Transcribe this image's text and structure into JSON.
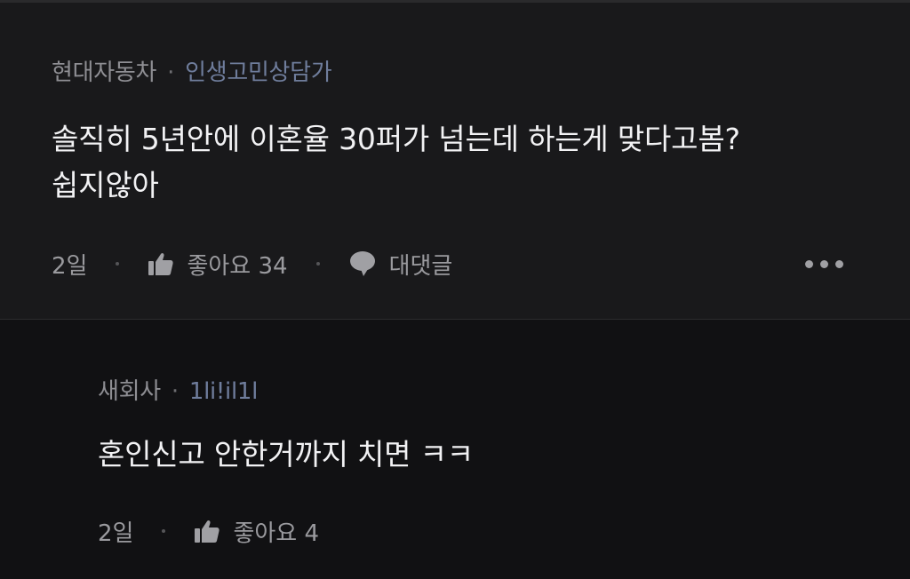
{
  "comments": [
    {
      "author": "현대자동차",
      "separator": "·",
      "tag": "인생고민상담가",
      "text_line1": "솔직히 5년안에 이혼율 30퍼가 넘는데 하는게 맞다고봄?",
      "text_line2": "쉽지않아",
      "time": "2일",
      "like_label": "좋아요 34",
      "reply_label": "대댓글",
      "icons": {
        "like": "thumbs-up-icon",
        "reply": "speech-bubble-icon",
        "more": "more-horizontal-icon"
      }
    },
    {
      "author": "새회사",
      "separator": "·",
      "tag": "1li!il1l",
      "text": "혼인신고 안한거까지 치면 ㅋㅋ",
      "time": "2일",
      "like_label": "좋아요 4",
      "icons": {
        "like": "thumbs-up-icon"
      }
    }
  ],
  "colors": {
    "background": "#111113",
    "first_comment_bg": "#19191b",
    "tag_color": "#6f7d9c",
    "text_primary": "#f2f2f4",
    "text_secondary": "#8e8e93"
  }
}
